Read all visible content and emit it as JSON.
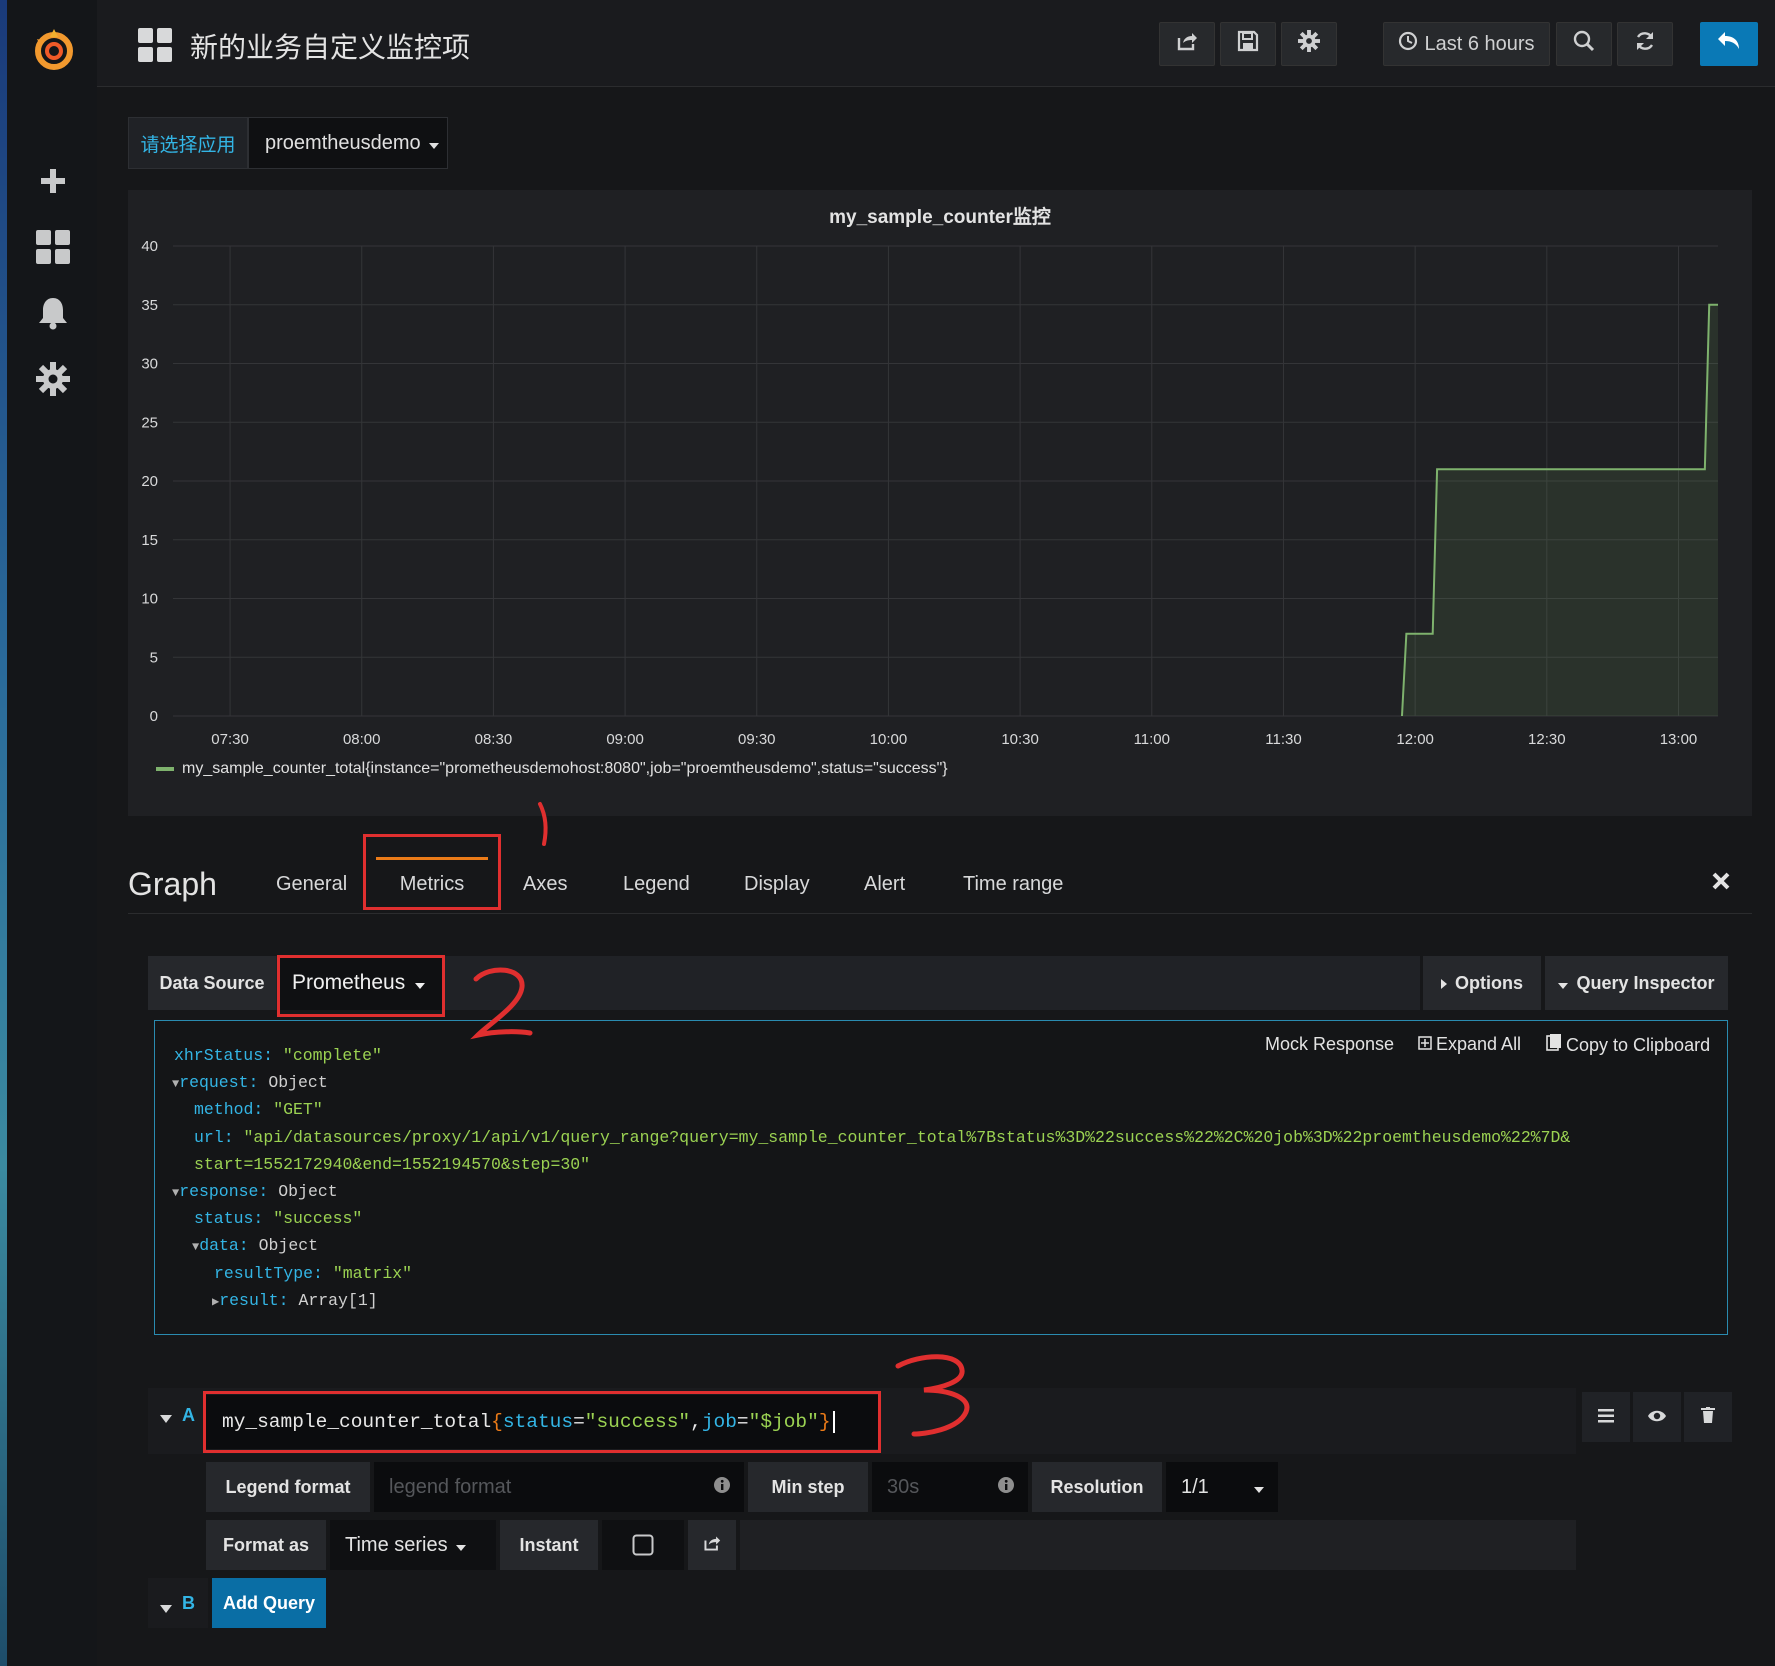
{
  "topbar": {
    "title": "新的业务自定义监控项",
    "time_range_label": "Last 6 hours"
  },
  "icons": [
    "grafana-logo-icon",
    "plus-icon",
    "dashboards-icon",
    "bell-icon",
    "gear-icon",
    "share-icon",
    "save-icon",
    "settings-icon",
    "clock-icon",
    "zoom-out-icon",
    "refresh-icon",
    "back-icon",
    "close-icon",
    "caret-down-icon",
    "trash-icon",
    "eye-icon",
    "hamburger-icon"
  ],
  "template_var": {
    "label": "请选择应用",
    "value": "proemtheusdemo"
  },
  "panel": {
    "title": "my_sample_counter监控",
    "legend": "my_sample_counter_total{instance=\"prometheusdemohost:8080\",job=\"proemtheusdemo\",status=\"success\"}"
  },
  "chart_data": {
    "type": "area",
    "title": "my_sample_counter监控",
    "x_ticks": [
      "07:30",
      "08:00",
      "08:30",
      "09:00",
      "09:30",
      "10:00",
      "10:30",
      "11:00",
      "11:30",
      "12:00",
      "12:30",
      "13:00"
    ],
    "y_ticks": [
      "0",
      "5",
      "10",
      "15",
      "20",
      "25",
      "30",
      "35",
      "40"
    ],
    "ylim": [
      0,
      40
    ],
    "xlim": [
      "07:17",
      "13:09"
    ],
    "grid": true,
    "legend_position": "bottom-left",
    "series": [
      {
        "name": "my_sample_counter_total{instance=\"prometheusdemohost:8080\",job=\"proemtheusdemo\",status=\"success\"}",
        "color": "#7eb26d",
        "points": [
          {
            "x": "11:57",
            "y": 0
          },
          {
            "x": "11:58",
            "y": 7
          },
          {
            "x": "12:04",
            "y": 7
          },
          {
            "x": "12:05",
            "y": 21
          },
          {
            "x": "13:06",
            "y": 21
          },
          {
            "x": "13:07",
            "y": 35
          },
          {
            "x": "13:09",
            "y": 35
          }
        ]
      }
    ]
  },
  "editor": {
    "title": "Graph",
    "tabs": [
      "General",
      "Metrics",
      "Axes",
      "Legend",
      "Display",
      "Alert",
      "Time range"
    ],
    "active_tab": "Metrics"
  },
  "datasource": {
    "label": "Data Source",
    "value": "Prometheus",
    "options_label": "Options",
    "inspector_label": "Query Inspector"
  },
  "inspector": {
    "mock_response": "Mock Response",
    "expand_all": "Expand All",
    "copy": "Copy to Clipboard",
    "lines": [
      {
        "key": "xhrStatus:",
        "value": "\"complete\"",
        "vtype": "s",
        "indent": 0,
        "arrow": ""
      },
      {
        "key": "request:",
        "value": "Object",
        "vtype": "o",
        "indent": 0,
        "arrow": "▼"
      },
      {
        "key": "method:",
        "value": "\"GET\"",
        "vtype": "s",
        "indent": 1,
        "arrow": ""
      },
      {
        "key": "url:",
        "value": "\"api/datasources/proxy/1/api/v1/query_range?query=my_sample_counter_total%7Bstatus%3D%22success%22%2C%20job%3D%22proemtheusdemo%22%7D&",
        "vtype": "s",
        "indent": 1,
        "arrow": ""
      },
      {
        "key": "",
        "value": "start=1552172940&end=1552194570&step=30\"",
        "vtype": "s",
        "indent": 1,
        "arrow": ""
      },
      {
        "key": "response:",
        "value": "Object",
        "vtype": "o",
        "indent": 0,
        "arrow": "▼"
      },
      {
        "key": "status:",
        "value": "\"success\"",
        "vtype": "s",
        "indent": 1,
        "arrow": ""
      },
      {
        "key": "data:",
        "value": "Object",
        "vtype": "o",
        "indent": 1,
        "arrow": "▼"
      },
      {
        "key": "resultType:",
        "value": "\"matrix\"",
        "vtype": "s",
        "indent": 2,
        "arrow": ""
      },
      {
        "key": "result:",
        "value": "Array[1]",
        "vtype": "o",
        "indent": 2,
        "arrow": "▶"
      }
    ]
  },
  "query_a": {
    "letter": "A",
    "expr_metric": "my_sample_counter_total",
    "expr_open": "{",
    "expr_k1": "status",
    "expr_eq": "=",
    "expr_v1": "\"success\"",
    "expr_sep": ", ",
    "expr_k2": "job",
    "expr_eq2": "=",
    "expr_v2": "\"$job\"",
    "expr_close": "}",
    "legend_format_label": "Legend format",
    "legend_format_placeholder": "legend format",
    "min_step_label": "Min step",
    "min_step_placeholder": "30s",
    "resolution_label": "Resolution",
    "resolution_value": "1/1",
    "format_as_label": "Format as",
    "format_as_value": "Time series",
    "instant_label": "Instant",
    "instant_checked": false
  },
  "query_b": {
    "letter": "B",
    "add_query_label": "Add Query"
  },
  "annotations": [
    "1",
    "2",
    "3"
  ]
}
